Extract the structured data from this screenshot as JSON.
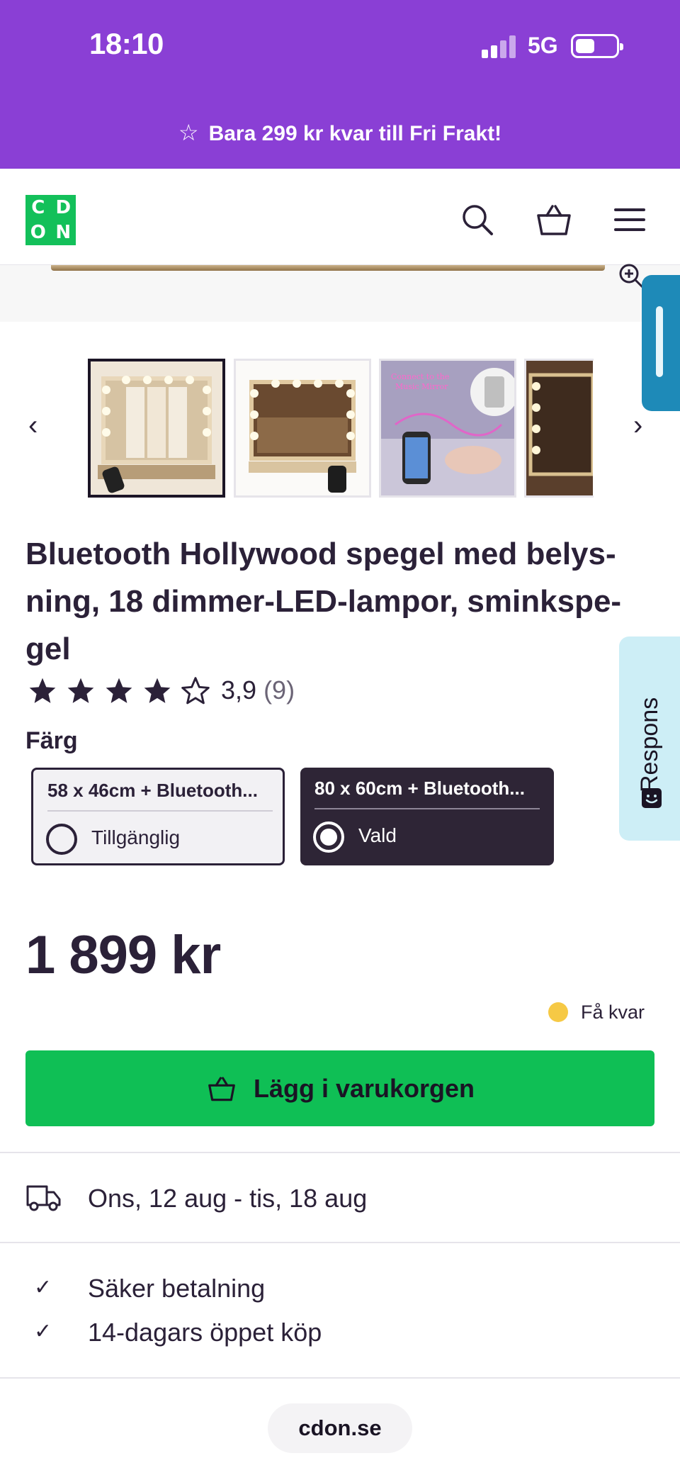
{
  "status_bar": {
    "time": "18:10",
    "network": "5G"
  },
  "promo_banner": {
    "text": "Bara 299 kr kvar till Fri Frakt!"
  },
  "header": {
    "logo_letters": [
      "C",
      "D",
      "O",
      "N"
    ],
    "icons": [
      "search-icon",
      "cart-icon",
      "menu-icon"
    ]
  },
  "product": {
    "title": "Bluetooth Hollywood spegel med belys-ning, 18 dimmer-LED-lampor, sminkspe-gel",
    "rating": {
      "value": "3,9",
      "count": "(9)",
      "stars_filled": 4,
      "stars_total": 5
    },
    "color_label": "Färg",
    "variants": [
      {
        "name": "58 x 46cm + Bluetooth...",
        "state": "Tillgänglig",
        "selected": false
      },
      {
        "name": "80 x 60cm + Bluetooth...",
        "state": "Vald",
        "selected": true
      }
    ],
    "price": "1 899 kr",
    "stock": {
      "text": "Få kvar",
      "color": "#f6c945"
    },
    "add_to_cart": "Lägg i varukorgen",
    "delivery": "Ons, 12 aug - tis, 18 aug",
    "perks": [
      "Säker betalning",
      "14-dagars öppet köp"
    ]
  },
  "feedback": {
    "label": "Respons"
  },
  "browser": {
    "url": "cdon.se"
  },
  "colors": {
    "brand_purple": "#8a3fd5",
    "brand_green": "#13c05a",
    "button_green": "#0fbf55",
    "dark": "#2e2536"
  }
}
